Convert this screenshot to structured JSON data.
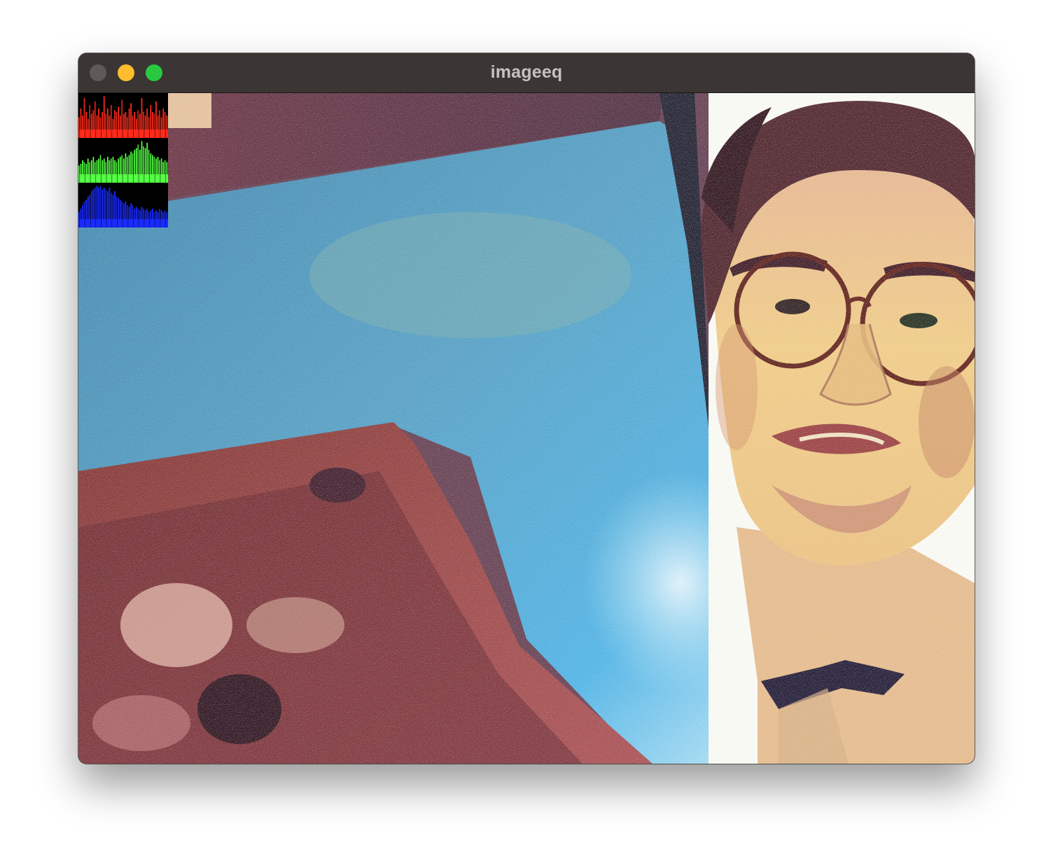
{
  "window": {
    "title": "imageeq"
  },
  "colors": {
    "titlebar": "#3b3533",
    "close": "#5f5a58",
    "minimize": "#febc2e",
    "maximize": "#28c840",
    "hist_red": "#ff2a1a",
    "hist_green": "#55ff44",
    "hist_blue": "#1a2bff"
  },
  "histograms": [
    {
      "channel": "red",
      "icon": "red-histogram",
      "levels": [
        0.35,
        0.6,
        0.4,
        0.9,
        0.5,
        0.3,
        0.7,
        0.45,
        0.55,
        0.8,
        0.4,
        0.6,
        0.35,
        0.5,
        0.95,
        0.45,
        0.6,
        0.4,
        0.7,
        0.3,
        0.55,
        0.5,
        0.65,
        0.4,
        0.85,
        0.45,
        0.5,
        0.35,
        0.6,
        0.75,
        0.4,
        0.5,
        0.3,
        0.55,
        0.45,
        0.9,
        0.5,
        0.4,
        0.6,
        0.35,
        0.7,
        0.5,
        0.45,
        0.8,
        0.4,
        0.55,
        0.35,
        0.6,
        0.5,
        0.4
      ]
    },
    {
      "channel": "green",
      "icon": "green-histogram",
      "levels": [
        0.25,
        0.3,
        0.4,
        0.35,
        0.3,
        0.45,
        0.35,
        0.4,
        0.5,
        0.35,
        0.4,
        0.45,
        0.55,
        0.4,
        0.45,
        0.35,
        0.5,
        0.4,
        0.45,
        0.5,
        0.4,
        0.35,
        0.45,
        0.5,
        0.55,
        0.45,
        0.6,
        0.5,
        0.55,
        0.65,
        0.6,
        0.7,
        0.75,
        0.85,
        0.7,
        0.95,
        0.8,
        0.75,
        0.9,
        0.7,
        0.6,
        0.55,
        0.5,
        0.45,
        0.5,
        0.4,
        0.45,
        0.35,
        0.4,
        0.35
      ]
    },
    {
      "channel": "blue",
      "icon": "blue-histogram",
      "levels": [
        0.2,
        0.3,
        0.4,
        0.5,
        0.55,
        0.65,
        0.7,
        0.8,
        0.85,
        0.9,
        0.95,
        0.9,
        0.95,
        0.85,
        0.9,
        0.85,
        0.8,
        0.9,
        0.75,
        0.7,
        0.8,
        0.65,
        0.6,
        0.55,
        0.5,
        0.45,
        0.5,
        0.4,
        0.35,
        0.45,
        0.4,
        0.3,
        0.35,
        0.3,
        0.25,
        0.35,
        0.3,
        0.25,
        0.3,
        0.2,
        0.25,
        0.3,
        0.2,
        0.25,
        0.2,
        0.3,
        0.25,
        0.2,
        0.25,
        0.2
      ]
    }
  ]
}
